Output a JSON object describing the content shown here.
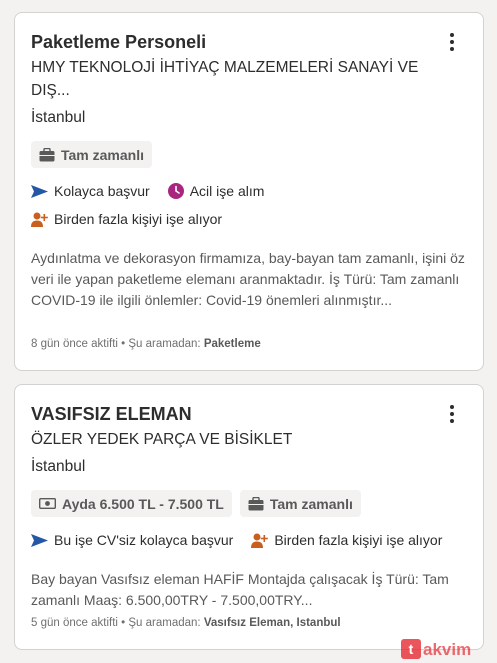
{
  "jobs": [
    {
      "title": "Paketleme Personeli",
      "company_line1": "HMY TEKNOLOJİ İHTİYAÇ MALZEMELERİ SANAYİ VE",
      "company_line2": "DIŞ...",
      "location": "İstanbul",
      "tags": [
        "Tam zamanlı"
      ],
      "feature_easy": "Kolayca başvur",
      "feature_urgent": "Acil işe alım",
      "feature_multi": "Birden fazla kişiyi işe alıyor",
      "snippet": "Aydınlatma ve dekorasyon firmamıza, bay-bayan tam zamanlı, işini öz veri ile yapan paketleme elemanı aranmaktadır. İş Türü: Tam zamanlı COVID-19 ile ilgili önlemler: Covid-19 önemleri alınmıştır...",
      "meta_prefix": "8 gün önce aktifti • Şu aramadan: ",
      "meta_search": "Paketleme"
    },
    {
      "title": "VASIFSIZ ELEMAN",
      "company_line1": "ÖZLER YEDEK PARÇA VE BİSİKLET",
      "location": "İstanbul",
      "tag_salary": "Ayda 6.500 TL - 7.500 TL",
      "tag_type": "Tam zamanlı",
      "feature_easy": "Bu işe CV'siz kolayca başvur",
      "feature_multi": "Birden fazla kişiyi işe alıyor",
      "snippet": "Bay bayan Vasıfsız eleman HAFİF Montajda çalışacak İş Türü: Tam zamanlı Maaş: 6.500,00TRY - 7.500,00TRY...",
      "meta_prefix": "5 gün önce aktifti • Şu aramadan: ",
      "meta_search": "Vasıfsız Eleman, Istanbul"
    }
  ],
  "watermark": "takvim"
}
